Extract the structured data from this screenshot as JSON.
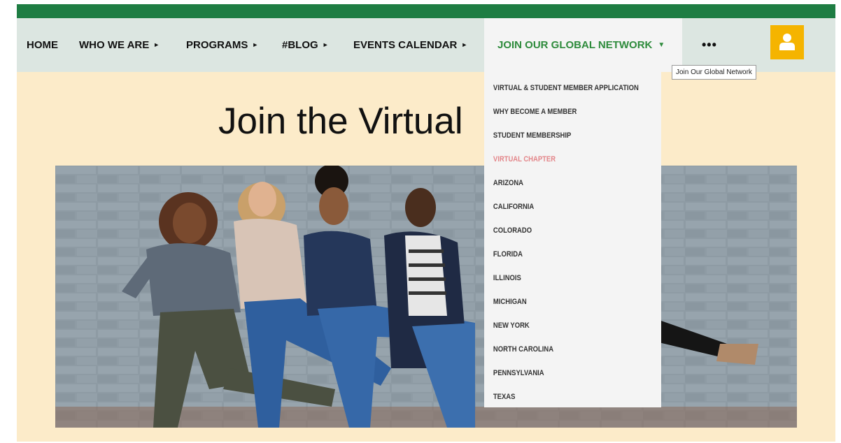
{
  "nav": {
    "items": [
      {
        "label": "HOME"
      },
      {
        "label": "WHO WE ARE"
      },
      {
        "label": "PROGRAMS"
      },
      {
        "label": "#BLOG"
      },
      {
        "label": "EVENTS CALENDAR"
      },
      {
        "label": "JOIN OUR GLOBAL NETWORK"
      }
    ],
    "more_label": "•••",
    "arrow_right": "►",
    "arrow_down": "▼",
    "active_color": "#2e8b3c"
  },
  "tooltip": "Join Our Global Network",
  "page": {
    "heading": "Join the Virtual"
  },
  "dropdown": {
    "items": [
      {
        "label": "VIRTUAL & STUDENT MEMBER APPLICATION"
      },
      {
        "label": "WHY BECOME A MEMBER"
      },
      {
        "label": "STUDENT MEMBERSHIP"
      },
      {
        "label": "VIRTUAL CHAPTER"
      },
      {
        "label": "ARIZONA"
      },
      {
        "label": "CALIFORNIA"
      },
      {
        "label": "COLORADO"
      },
      {
        "label": "FLORIDA"
      },
      {
        "label": "ILLINOIS"
      },
      {
        "label": "MICHIGAN"
      },
      {
        "label": "NEW YORK"
      },
      {
        "label": "NORTH CAROLINA"
      },
      {
        "label": "PENNSYLVANIA"
      },
      {
        "label": "TEXAS"
      }
    ],
    "current_color": "#e3868a"
  },
  "icons": {
    "user": "user-icon"
  },
  "colors": {
    "top_bar": "#1e7d43",
    "nav_background": "#dce6e1",
    "page_background": "#fcebc9",
    "user_button": "#f5b400"
  }
}
